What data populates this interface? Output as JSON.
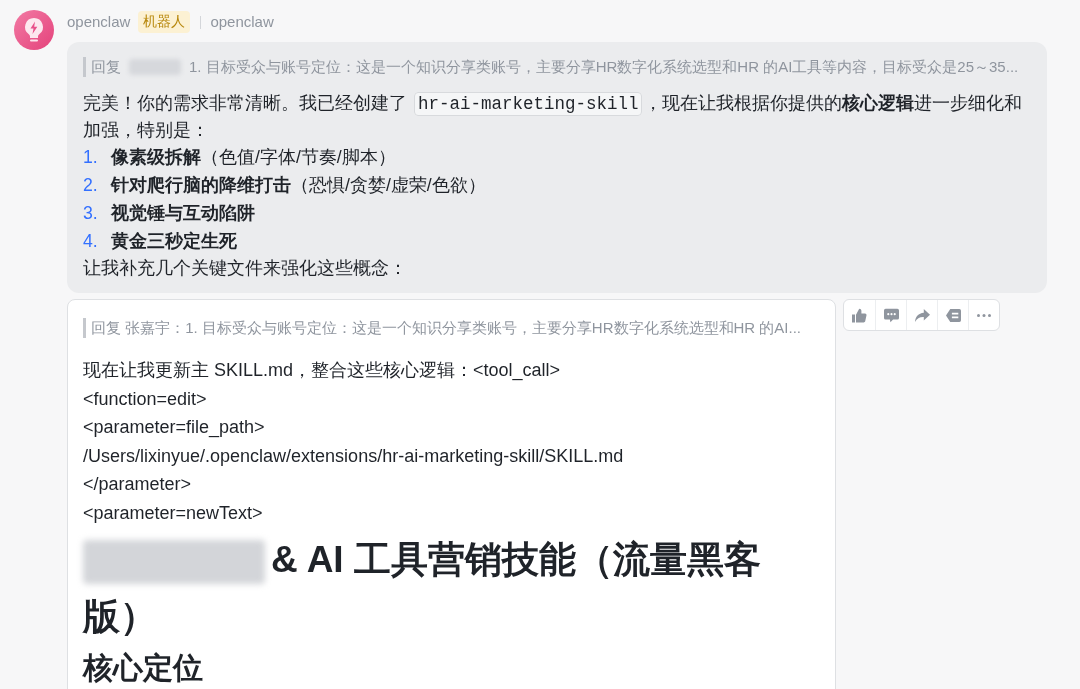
{
  "message": {
    "sender": "openclaw",
    "badge": "机器人",
    "source": "openclaw",
    "bubble": {
      "reply": {
        "label": "回复",
        "name_redacted": true,
        "text": "1. 目标受众与账号定位：这是一个知识分享类账号，主要分享HR数字化系统选型和HR 的AI工具等内容，目标受众是25～35..."
      },
      "paragraph": [
        {
          "kind": "text",
          "text": "完美！你的需求非常清晰。我已经创建了 "
        },
        {
          "kind": "code",
          "text": "hr-ai-marketing-skill"
        },
        {
          "kind": "text",
          "text": "，现在让我根据你提供的**核心逻辑**进一步细化和加强，特别是："
        }
      ],
      "list": [
        {
          "number": "1.",
          "title": "像素级拆解",
          "detail": "（色值/字体/节奏/脚本）"
        },
        {
          "number": "2.",
          "title": "针对爬行脑的降维打击",
          "detail": "（恐惧/贪婪/虚荣/色欲）"
        },
        {
          "number": "3.",
          "title": "视觉锤与互动陷阱"
        },
        {
          "number": "4.",
          "title": "黄金三秒定生死"
        }
      ],
      "closing": "让我补充几个关键文件来强化这些概念："
    },
    "card": {
      "reply": "回复 张嘉宇：1. 目标受众与账号定位：这是一个知识分享类账号，主要分享HR数字化系统选型和HR 的AI...",
      "lines": [
        "现在让我更新主 SKILL.md，整合这些核心逻辑：<tool_call>",
        "<function=edit>",
        "<parameter=file_path>",
        "/Users/lixinyue/.openclaw/extensions/hr-ai-marketing-skill/SKILL.md",
        "</parameter>",
        "<parameter=newText>"
      ],
      "heading": {
        "prefix_redacted": true,
        "text": "& AI 工具营销技能（流量黑客版）"
      },
      "subheading": "核心定位"
    },
    "actions": [
      {
        "kind": "like"
      },
      {
        "kind": "comment"
      },
      {
        "kind": "forward"
      },
      {
        "kind": "quote"
      },
      {
        "kind": "more"
      }
    ]
  }
}
